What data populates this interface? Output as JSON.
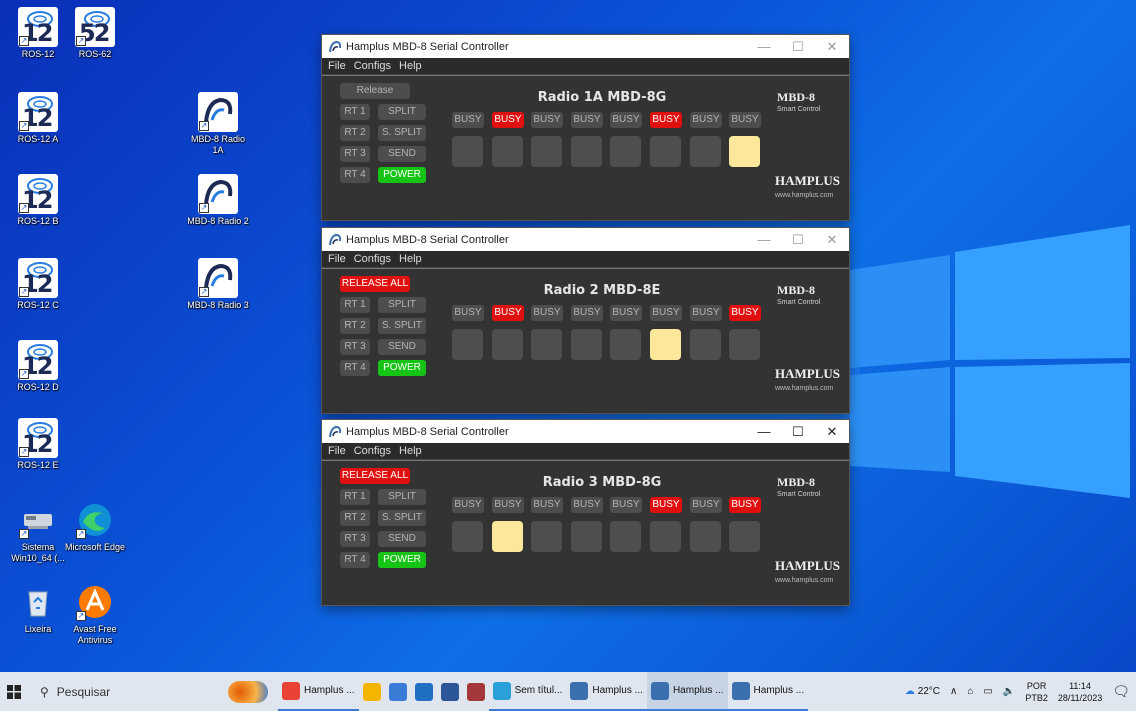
{
  "desktop": {
    "icons_left": [
      {
        "num": "12",
        "label": "ROS-12"
      },
      {
        "num": "12",
        "label": "ROS-12 A"
      },
      {
        "num": "12",
        "label": "ROS-12 B"
      },
      {
        "num": "12",
        "label": "ROS-12 C"
      },
      {
        "num": "12",
        "label": "ROS-12 D"
      },
      {
        "num": "12",
        "label": "ROS-12 E"
      }
    ],
    "icon_ros62": {
      "num": "52",
      "label": "ROS-62"
    },
    "icons_mbd": [
      {
        "label": "MBD-8 Radio 1A"
      },
      {
        "label": "MBD-8 Radio 2"
      },
      {
        "label": "MBD-8 Radio 3"
      }
    ],
    "sistema": {
      "label": "Sistema Win10_64 (..."
    },
    "edge": {
      "label": "Microsoft Edge"
    },
    "lixeira": {
      "label": "Lixeira"
    },
    "avast": {
      "label": "Avast Free Antivirus"
    }
  },
  "windows": [
    {
      "title": "Hamplus MBD-8 Serial Controller",
      "menu": [
        "File",
        "Configs",
        "Help"
      ],
      "release": {
        "label": "Release",
        "state": "off"
      },
      "radio_title": "Radio 1A  MBD-8G",
      "rt": [
        "RT 1",
        "RT 2",
        "RT 3",
        "RT 4"
      ],
      "functions": [
        {
          "label": "SPLIT",
          "state": "off"
        },
        {
          "label": "S. SPLIT",
          "state": "off"
        },
        {
          "label": "SEND",
          "state": "off"
        },
        {
          "label": "POWER",
          "state": "on"
        }
      ],
      "busy": [
        {
          "label": "BUSY",
          "on": false
        },
        {
          "label": "BUSY",
          "on": true
        },
        {
          "label": "BUSY",
          "on": false
        },
        {
          "label": "BUSY",
          "on": false
        },
        {
          "label": "BUSY",
          "on": false
        },
        {
          "label": "BUSY",
          "on": true
        },
        {
          "label": "BUSY",
          "on": false
        },
        {
          "label": "BUSY",
          "on": false
        }
      ],
      "slots_lit": [
        false,
        false,
        false,
        false,
        false,
        false,
        false,
        true
      ],
      "brand_model": "MBD-8",
      "brand_sub": "Smart Control",
      "brand_name": "HAMPLUS",
      "brand_url": "www.hamplus.com"
    },
    {
      "title": "Hamplus MBD-8 Serial Controller",
      "menu": [
        "File",
        "Configs",
        "Help"
      ],
      "release": {
        "label": "RELEASE ALL",
        "state": "on"
      },
      "radio_title": "Radio 2  MBD-8E",
      "rt": [
        "RT 1",
        "RT 2",
        "RT 3",
        "RT 4"
      ],
      "functions": [
        {
          "label": "SPLIT",
          "state": "off"
        },
        {
          "label": "S. SPLIT",
          "state": "off"
        },
        {
          "label": "SEND",
          "state": "off"
        },
        {
          "label": "POWER",
          "state": "on"
        }
      ],
      "busy": [
        {
          "label": "BUSY",
          "on": false
        },
        {
          "label": "BUSY",
          "on": true
        },
        {
          "label": "BUSY",
          "on": false
        },
        {
          "label": "BUSY",
          "on": false
        },
        {
          "label": "BUSY",
          "on": false
        },
        {
          "label": "BUSY",
          "on": false
        },
        {
          "label": "BUSY",
          "on": false
        },
        {
          "label": "BUSY",
          "on": true
        }
      ],
      "slots_lit": [
        false,
        false,
        false,
        false,
        false,
        true,
        false,
        false
      ],
      "brand_model": "MBD-8",
      "brand_sub": "Smart Control",
      "brand_name": "HAMPLUS",
      "brand_url": "www.hamplus.com"
    },
    {
      "title": "Hamplus MBD-8 Serial Controller",
      "menu": [
        "File",
        "Configs",
        "Help"
      ],
      "release": {
        "label": "RELEASE ALL",
        "state": "on"
      },
      "radio_title": "Radio 3  MBD-8G",
      "rt": [
        "RT 1",
        "RT 2",
        "RT 3",
        "RT 4"
      ],
      "functions": [
        {
          "label": "SPLIT",
          "state": "off"
        },
        {
          "label": "S. SPLIT",
          "state": "off"
        },
        {
          "label": "SEND",
          "state": "off"
        },
        {
          "label": "POWER",
          "state": "on"
        }
      ],
      "busy": [
        {
          "label": "BUSY",
          "on": false
        },
        {
          "label": "BUSY",
          "on": false
        },
        {
          "label": "BUSY",
          "on": false
        },
        {
          "label": "BUSY",
          "on": false
        },
        {
          "label": "BUSY",
          "on": false
        },
        {
          "label": "BUSY",
          "on": true
        },
        {
          "label": "BUSY",
          "on": false
        },
        {
          "label": "BUSY",
          "on": true
        }
      ],
      "slots_lit": [
        false,
        true,
        false,
        false,
        false,
        false,
        false,
        false
      ],
      "brand_model": "MBD-8",
      "brand_sub": "Smart Control",
      "brand_name": "HAMPLUS",
      "brand_url": "www.hamplus.com"
    }
  ],
  "window_controls": {
    "minimize": "—",
    "maximize": "☐",
    "close": "✕"
  },
  "taskbar": {
    "search_placeholder": "Pesquisar",
    "apps": [
      {
        "label": "Hamplus ...",
        "icon": "chrome-icon",
        "color": "#ea4335",
        "running": true,
        "active": false
      },
      {
        "label": "",
        "icon": "file-explorer-icon",
        "color": "#f4b400",
        "running": false,
        "active": false
      },
      {
        "label": "",
        "icon": "store-icon",
        "color": "#3a7bd5",
        "running": false,
        "active": false
      },
      {
        "label": "",
        "icon": "mail-icon",
        "color": "#1f6fc5",
        "running": false,
        "active": false
      },
      {
        "label": "",
        "icon": "word-icon",
        "color": "#2b579a",
        "running": false,
        "active": false
      },
      {
        "label": "",
        "icon": "access-icon",
        "color": "#a4373a",
        "running": false,
        "active": false
      },
      {
        "label": "Sem títul...",
        "icon": "paint-icon",
        "color": "#2aa0d8",
        "running": true,
        "active": false
      },
      {
        "label": "Hamplus ...",
        "icon": "hamplus-icon",
        "color": "#3c6fb0",
        "running": true,
        "active": false
      },
      {
        "label": "Hamplus ...",
        "icon": "hamplus-icon",
        "color": "#3c6fb0",
        "running": true,
        "active": true
      },
      {
        "label": "Hamplus ...",
        "icon": "hamplus-icon",
        "color": "#3c6fb0",
        "running": true,
        "active": false
      }
    ],
    "weather": "22°C",
    "lang_top": "POR",
    "lang_bottom": "PTB2",
    "time": "11:14",
    "date": "28/11/2023"
  },
  "colors": {
    "busy_on": "#e01010",
    "power_on": "#16c416",
    "slot_lit": "#fde79a",
    "panel": "#333333"
  }
}
